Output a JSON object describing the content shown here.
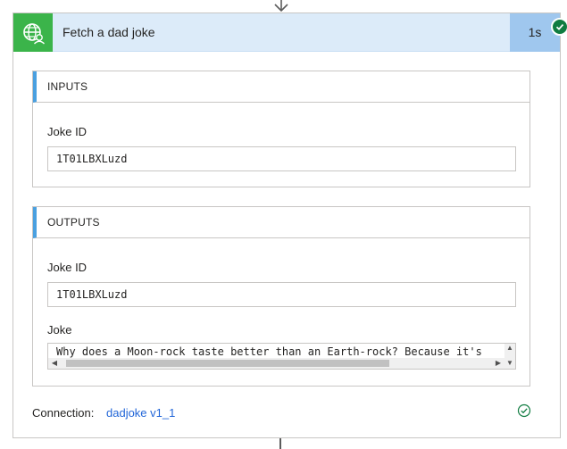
{
  "action": {
    "title": "Fetch a dad joke",
    "duration": "1s",
    "icon": "globe-person-icon",
    "status": "succeeded"
  },
  "inputs": {
    "header": "INPUTS",
    "fields": [
      {
        "label": "Joke ID",
        "value": "1T01LBXLuzd"
      }
    ]
  },
  "outputs": {
    "header": "OUTPUTS",
    "fields": [
      {
        "label": "Joke ID",
        "value": "1T01LBXLuzd"
      },
      {
        "label": "Joke",
        "value": "Why does a Moon-rock taste better than an Earth-rock? Because it's"
      }
    ]
  },
  "connection": {
    "label": "Connection:",
    "name": "dadjoke v1_1"
  },
  "colors": {
    "header_bg": "#dcebf9",
    "icon_bg": "#3bb44a",
    "duration_bg": "#9fc7ee",
    "section_accent": "#4aa0e0",
    "success": "#107c41",
    "link": "#2266d8"
  }
}
